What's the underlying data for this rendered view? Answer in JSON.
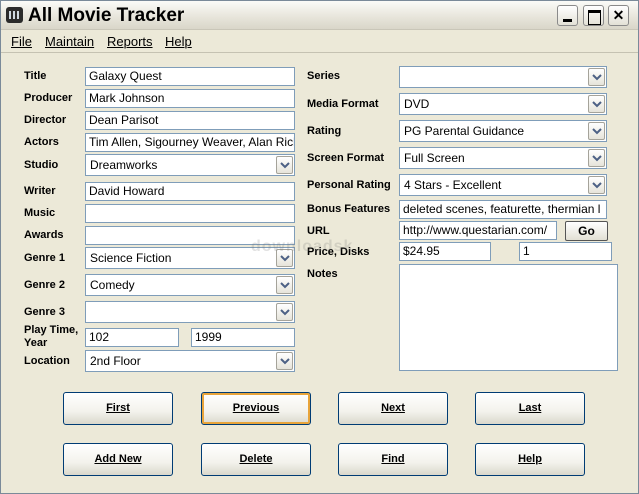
{
  "window": {
    "title": "All Movie Tracker",
    "close_glyph": "✕"
  },
  "menu": [
    "File",
    "Maintain",
    "Reports",
    "Help"
  ],
  "left": {
    "title": {
      "label": "Title",
      "value": "Galaxy Quest"
    },
    "producer": {
      "label": "Producer",
      "value": "Mark Johnson"
    },
    "director": {
      "label": "Director",
      "value": "Dean Parisot"
    },
    "actors": {
      "label": "Actors",
      "value": "Tim Allen, Sigourney Weaver, Alan Rickman"
    },
    "studio": {
      "label": "Studio",
      "value": "Dreamworks"
    },
    "writer": {
      "label": "Writer",
      "value": "David Howard"
    },
    "music": {
      "label": "Music",
      "value": ""
    },
    "awards": {
      "label": "Awards",
      "value": ""
    },
    "genre1": {
      "label": "Genre 1",
      "value": "Science Fiction"
    },
    "genre2": {
      "label": "Genre 2",
      "value": "Comedy"
    },
    "genre3": {
      "label": "Genre 3",
      "value": ""
    },
    "playtime": {
      "label_line1": "Play Time,",
      "label_line2": "Year",
      "time": "102",
      "year": "1999"
    },
    "location": {
      "label": "Location",
      "value": "2nd Floor"
    }
  },
  "right": {
    "series": {
      "label": "Series",
      "value": ""
    },
    "media_format": {
      "label": "Media Format",
      "value": "DVD"
    },
    "rating": {
      "label": "Rating",
      "value": "PG Parental Guidance"
    },
    "screen_format": {
      "label": "Screen Format",
      "value": "Full Screen"
    },
    "personal_rating": {
      "label": "Personal Rating",
      "value": "4 Stars - Excellent"
    },
    "bonus": {
      "label": "Bonus Features",
      "value": "deleted scenes, featurette, thermian l"
    },
    "url": {
      "label": "URL",
      "value": "http://www.questarian.com/",
      "go": "Go"
    },
    "price": {
      "label": "Price, Disks",
      "price": "$24.95",
      "disks": "1"
    },
    "notes": {
      "label": "Notes",
      "value": ""
    }
  },
  "buttons": {
    "first": "First",
    "previous": "Previous",
    "next": "Next",
    "last": "Last",
    "add_new": "Add New",
    "delete": "Delete",
    "find": "Find",
    "help": "Help"
  },
  "watermark": "downloadsk"
}
